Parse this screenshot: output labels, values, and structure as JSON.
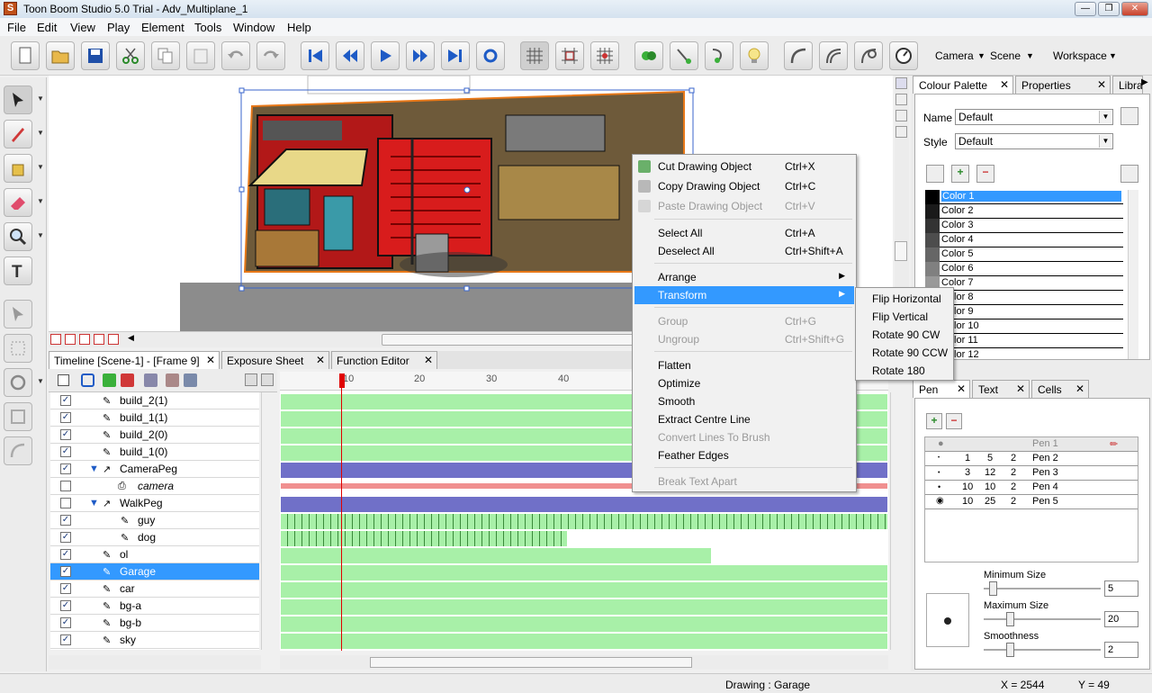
{
  "window": {
    "title": "Toon Boom Studio 5.0 Trial - Adv_Multiplane_1",
    "app_icon": "S",
    "minimize": "—",
    "restore": "❐",
    "close": "✕"
  },
  "menubar": [
    "File",
    "Edit",
    "View",
    "Play",
    "Element",
    "Tools",
    "Window",
    "Help"
  ],
  "toolbar": {
    "camera": "Camera",
    "scene": "Scene",
    "workspace": "Workspace",
    "icons": [
      "new-file-icon",
      "open-folder-icon",
      "save-icon",
      "cut-icon",
      "copy-icon",
      "paste-icon",
      "undo-icon",
      "redo-icon",
      "first-frame-icon",
      "previous-frame-icon",
      "play-icon",
      "next-frame-icon",
      "last-frame-icon",
      "loop-icon",
      "grid-icon",
      "field-grid-icon",
      "safe-area-icon",
      "onion-skin-icon",
      "light-table-icon",
      "brush-curve-icon",
      "lightbulb-icon",
      "curve-icon",
      "shape-icon",
      "shape2-icon",
      "timer-icon"
    ]
  },
  "timeline": {
    "tabs": [
      {
        "label": "Timeline [Scene-1] - [Frame 9]",
        "close": "✕"
      },
      {
        "label": "Exposure Sheet",
        "close": "✕"
      },
      {
        "label": "Function Editor",
        "close": "✕"
      }
    ],
    "frame_ruler": [
      "10",
      "20",
      "30",
      "40"
    ],
    "current_frame": 9,
    "layers": [
      {
        "name": "build_2(1)",
        "checked": true,
        "selected": false,
        "italic": false
      },
      {
        "name": "build_1(1)",
        "checked": true,
        "selected": false,
        "italic": false
      },
      {
        "name": "build_2(0)",
        "checked": true,
        "selected": false,
        "italic": false
      },
      {
        "name": "build_1(0)",
        "checked": true,
        "selected": false,
        "italic": false
      },
      {
        "name": "CameraPeg",
        "checked": true,
        "selected": false,
        "italic": false
      },
      {
        "name": "camera",
        "checked": false,
        "selected": false,
        "italic": true
      },
      {
        "name": "WalkPeg",
        "checked": false,
        "selected": false,
        "italic": false
      },
      {
        "name": "guy",
        "checked": true,
        "selected": false,
        "italic": false
      },
      {
        "name": "dog",
        "checked": true,
        "selected": false,
        "italic": false
      },
      {
        "name": "ol",
        "checked": true,
        "selected": false,
        "italic": false
      },
      {
        "name": "Garage",
        "checked": true,
        "selected": true,
        "italic": false
      },
      {
        "name": "car",
        "checked": true,
        "selected": false,
        "italic": false
      },
      {
        "name": "bg-a",
        "checked": true,
        "selected": false,
        "italic": false
      },
      {
        "name": "bg-b",
        "checked": true,
        "selected": false,
        "italic": false
      },
      {
        "name": "sky",
        "checked": true,
        "selected": false,
        "italic": false
      }
    ]
  },
  "context_menu": {
    "items": [
      {
        "label": "Cut Drawing Object",
        "shortcut": "Ctrl+X",
        "enabled": true
      },
      {
        "label": "Copy Drawing Object",
        "shortcut": "Ctrl+C",
        "enabled": true
      },
      {
        "label": "Paste Drawing Object",
        "shortcut": "Ctrl+V",
        "enabled": false
      },
      {
        "label": "Select All",
        "shortcut": "Ctrl+A",
        "enabled": true
      },
      {
        "label": "Deselect All",
        "shortcut": "Ctrl+Shift+A",
        "enabled": true
      },
      {
        "label": "Arrange",
        "shortcut": "",
        "enabled": true
      },
      {
        "label": "Transform",
        "shortcut": "",
        "enabled": true
      },
      {
        "label": "Group",
        "shortcut": "Ctrl+G",
        "enabled": false
      },
      {
        "label": "Ungroup",
        "shortcut": "Ctrl+Shift+G",
        "enabled": false
      },
      {
        "label": "Flatten",
        "shortcut": "",
        "enabled": true
      },
      {
        "label": "Optimize",
        "shortcut": "",
        "enabled": true
      },
      {
        "label": "Smooth",
        "shortcut": "",
        "enabled": true
      },
      {
        "label": "Extract Centre Line",
        "shortcut": "",
        "enabled": true
      },
      {
        "label": "Convert Lines To Brush",
        "shortcut": "",
        "enabled": false
      },
      {
        "label": "Feather Edges",
        "shortcut": "",
        "enabled": true
      },
      {
        "label": "Break Text Apart",
        "shortcut": "",
        "enabled": false
      }
    ],
    "highlighted": "Transform",
    "submenu_arrow": "▶"
  },
  "transform_submenu": [
    "Flip Horizontal",
    "Flip Vertical",
    "Rotate 90 CW",
    "Rotate 90 CCW",
    "Rotate 180"
  ],
  "colour_palette": {
    "tabs": [
      {
        "label": "Colour Palette",
        "close": "✕"
      },
      {
        "label": "Properties",
        "close": "✕"
      },
      {
        "label": "Library"
      }
    ],
    "name_label": "Name",
    "name_value": "Default",
    "style_label": "Style",
    "style_value": "Default",
    "colors": [
      {
        "name": "Color 1",
        "swatch": "#000000",
        "selected": true
      },
      {
        "name": "Color 2",
        "swatch": "#1a1a1a"
      },
      {
        "name": "Color 3",
        "swatch": "#333333"
      },
      {
        "name": "Color 4",
        "swatch": "#4d4d4d"
      },
      {
        "name": "Color 5",
        "swatch": "#666666"
      },
      {
        "name": "Color 6",
        "swatch": "#808080"
      },
      {
        "name": "Color 7",
        "swatch": "#999999"
      },
      {
        "name": "Color 8",
        "swatch": "#b3b3b3"
      },
      {
        "name": "Color 9",
        "swatch": "#cccccc"
      },
      {
        "name": "Color 10",
        "swatch": "#dddddd"
      },
      {
        "name": "Color 11",
        "swatch": "#eeeeee"
      },
      {
        "name": "Color 12",
        "swatch": "#ffffff"
      }
    ]
  },
  "pen_panel": {
    "tabs": [
      {
        "label": "Pen",
        "close": "✕"
      },
      {
        "label": "Text",
        "close": "✕"
      },
      {
        "label": "Cells",
        "close": "✕"
      }
    ],
    "header": [
      "",
      "",
      "",
      "",
      "Pen 1"
    ],
    "rows": [
      {
        "a": "1",
        "b": "5",
        "c": "2",
        "name": "Pen 2"
      },
      {
        "a": "3",
        "b": "12",
        "c": "2",
        "name": "Pen 3"
      },
      {
        "a": "10",
        "b": "10",
        "c": "2",
        "name": "Pen 4"
      },
      {
        "a": "10",
        "b": "25",
        "c": "2",
        "name": "Pen 5"
      }
    ],
    "min_size_label": "Minimum Size",
    "min_size": "5",
    "max_size_label": "Maximum Size",
    "max_size": "20",
    "smoothness_label": "Smoothness",
    "smoothness": "2"
  },
  "status": {
    "drawing": "Drawing : Garage",
    "x": "X = 2544",
    "y": "Y = 49"
  },
  "colors": {
    "selection": "#3399ff",
    "frame_fill": "#a8f0a8",
    "peg_fill": "#7070c8",
    "playhead": "#e00000"
  }
}
